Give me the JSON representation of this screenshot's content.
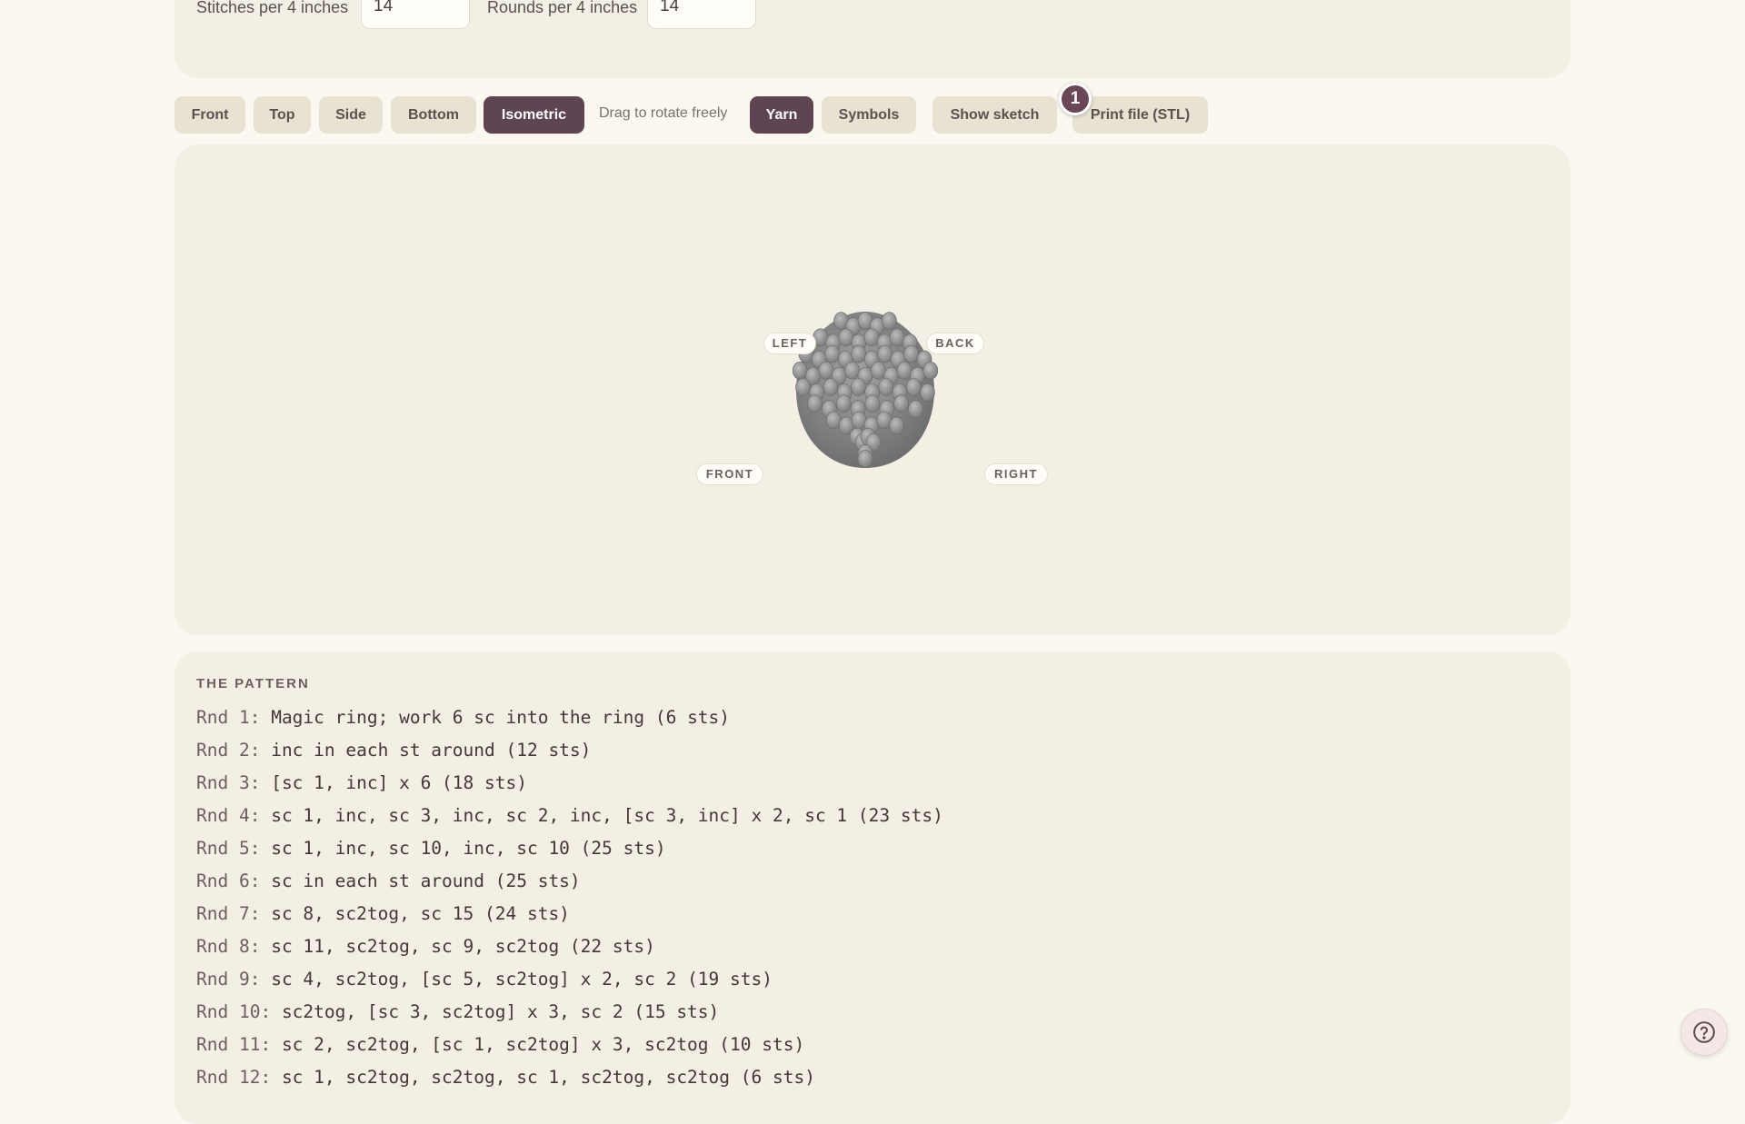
{
  "gauge": {
    "stitches_label": "Stitches per 4 inches",
    "stitches_value": "14",
    "rounds_label": "Rounds per 4 inches",
    "rounds_value": "14"
  },
  "toolbar": {
    "views": [
      {
        "label": "Front",
        "active": false
      },
      {
        "label": "Top",
        "active": false
      },
      {
        "label": "Side",
        "active": false
      },
      {
        "label": "Bottom",
        "active": false
      },
      {
        "label": "Isometric",
        "active": true
      }
    ],
    "hint": "Drag to rotate freely",
    "modes": [
      {
        "label": "Yarn",
        "active": true
      },
      {
        "label": "Symbols",
        "active": false
      }
    ],
    "show_sketch": "Show sketch",
    "print_file": "Print file (STL)",
    "badge_count": "1"
  },
  "viewer": {
    "labels": {
      "left": "LEFT",
      "back": "BACK",
      "front": "FRONT",
      "right": "RIGHT"
    },
    "model_color": "#8f8f8f"
  },
  "pattern": {
    "heading": "THE PATTERN",
    "rounds": [
      {
        "label": "Rnd 1:",
        "text": "Magic ring; work 6 sc into the ring (6 sts)"
      },
      {
        "label": "Rnd 2:",
        "text": "inc in each st around (12 sts)"
      },
      {
        "label": "Rnd 3:",
        "text": "[sc 1, inc] x 6 (18 sts)"
      },
      {
        "label": "Rnd 4:",
        "text": "sc 1, inc, sc 3, inc, sc 2, inc, [sc 3, inc] x 2, sc 1 (23 sts)"
      },
      {
        "label": "Rnd 5:",
        "text": "sc 1, inc, sc 10, inc, sc 10 (25 sts)"
      },
      {
        "label": "Rnd 6:",
        "text": "sc in each st around (25 sts)"
      },
      {
        "label": "Rnd 7:",
        "text": "sc 8, sc2tog, sc 15 (24 sts)"
      },
      {
        "label": "Rnd 8:",
        "text": "sc 11, sc2tog, sc 9, sc2tog (22 sts)"
      },
      {
        "label": "Rnd 9:",
        "text": "sc 4, sc2tog, [sc 5, sc2tog] x 2, sc 2 (19 sts)"
      },
      {
        "label": "Rnd 10:",
        "text": "sc2tog, [sc 3, sc2tog] x 3, sc 2 (15 sts)"
      },
      {
        "label": "Rnd 11:",
        "text": "sc 2, sc2tog, [sc 1, sc2tog] x 3, sc2tog (10 sts)"
      },
      {
        "label": "Rnd 12:",
        "text": "sc 1, sc2tog, sc2tog, sc 1, sc2tog, sc2tog (6 sts)"
      }
    ]
  },
  "colors": {
    "page_bg": "#fbf8f0",
    "panel_bg": "#f3efe5",
    "button_bg": "#e8e2d3",
    "active_button_bg": "#5e4551",
    "badge_bg": "#6b4656"
  },
  "icons": {
    "help": "question-circle-icon"
  }
}
